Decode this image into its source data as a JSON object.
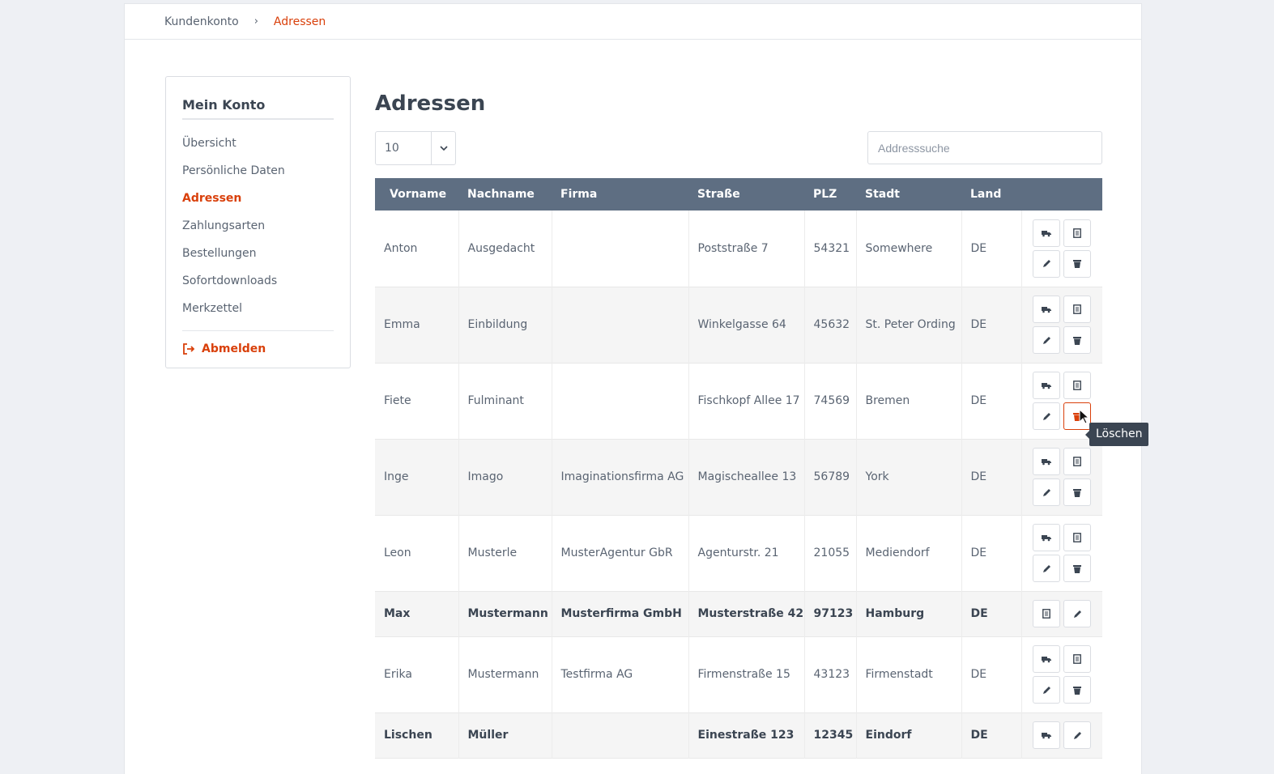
{
  "breadcrumb": {
    "parent": "Kundenkonto",
    "separator": "›",
    "current": "Adressen"
  },
  "sidebar": {
    "title": "Mein Konto",
    "items": [
      {
        "label": "Übersicht",
        "active": false
      },
      {
        "label": "Persönliche Daten",
        "active": false
      },
      {
        "label": "Adressen",
        "active": true
      },
      {
        "label": "Zahlungsarten",
        "active": false
      },
      {
        "label": "Bestellungen",
        "active": false
      },
      {
        "label": "Sofortdownloads",
        "active": false
      },
      {
        "label": "Merkzettel",
        "active": false
      }
    ],
    "logout": "Abmelden"
  },
  "main": {
    "title": "Adressen",
    "per_page": "10",
    "search_placeholder": "Addresssuche"
  },
  "table": {
    "headers": [
      "Vorname",
      "Nachname",
      "Firma",
      "Straße",
      "PLZ",
      "Stadt",
      "Land"
    ],
    "rows": [
      {
        "cells": [
          "Anton",
          "Ausgedacht",
          "",
          "Poststraße 7",
          "54321",
          "Somewhere",
          "DE"
        ],
        "default": false
      },
      {
        "cells": [
          "Emma",
          "Einbildung",
          "",
          "Winkelgasse 64",
          "45632",
          "St. Peter Ording",
          "DE"
        ],
        "default": false
      },
      {
        "cells": [
          "Fiete",
          "Fulminant",
          "",
          "Fischkopf Allee 17",
          "74569",
          "Bremen",
          "DE"
        ],
        "default": false,
        "hover_delete": true
      },
      {
        "cells": [
          "Inge",
          "Imago",
          "Imaginationsfirma AG",
          "Magischeallee 13",
          "56789",
          "York",
          "DE"
        ],
        "default": false
      },
      {
        "cells": [
          "Leon",
          "Musterle",
          "MusterAgentur GbR",
          "Agenturstr. 21",
          "21055",
          "Mediendorf",
          "DE"
        ],
        "default": false
      },
      {
        "cells": [
          "Max",
          "Mustermann",
          "Musterfirma GmbH",
          "Musterstraße 42",
          "97123",
          "Hamburg",
          "DE"
        ],
        "default": true,
        "buttons": [
          "invoice",
          "edit"
        ]
      },
      {
        "cells": [
          "Erika",
          "Mustermann",
          "Testfirma AG",
          "Firmenstraße 15",
          "43123",
          "Firmenstadt",
          "DE"
        ],
        "default": false
      },
      {
        "cells": [
          "Lischen",
          "Müller",
          "",
          "Einestraße 123",
          "12345",
          "Eindorf",
          "DE"
        ],
        "default": true,
        "buttons": [
          "shipping",
          "edit"
        ]
      }
    ]
  },
  "tooltip": "Löschen",
  "colors": {
    "accent": "#d9400b",
    "table_header": "#5e6e82",
    "text": "#5a6472"
  },
  "icons": {
    "shipping": "truck-icon",
    "invoice": "document-icon",
    "edit": "pencil-icon",
    "delete": "trash-icon",
    "logout": "logout-icon",
    "caret": "chevron-down-icon"
  }
}
